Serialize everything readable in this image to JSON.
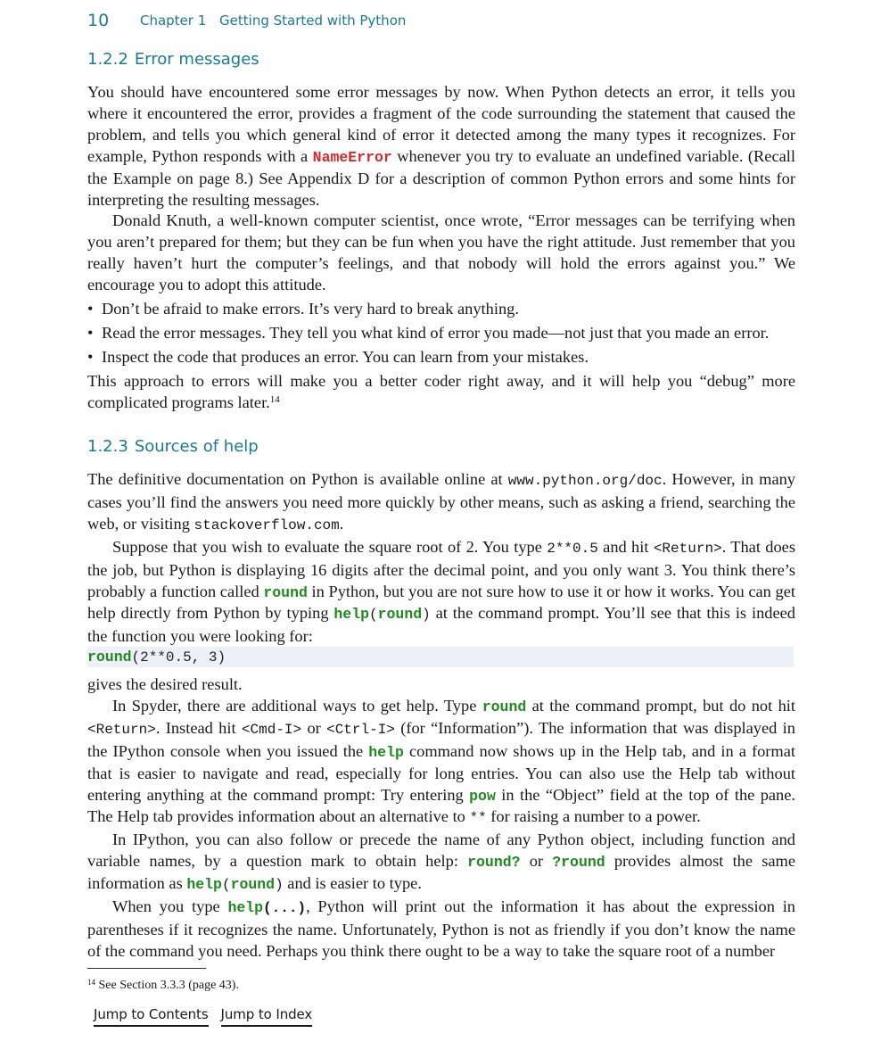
{
  "header": {
    "page_number": "10",
    "chapter_label": "Chapter 1",
    "chapter_title": "Getting Started with Python"
  },
  "section_122": {
    "number": "1.2.2",
    "title": "Error messages",
    "p1_a": "You should have encountered some error messages by now. When Python detects an error, it tells you where it encountered the error, provides a fragment of the code surrounding the statement that caused the problem, and tells you which general kind of error it detected among the many types it recognizes. For example, Python responds with a ",
    "p1_code": "NameError",
    "p1_b": " whenever you try to evaluate an undefined variable. (Recall the Example on page 8.) See Appendix D for a description of common Python errors and some hints for interpreting the resulting messages.",
    "p2": "Donald Knuth, a well-known computer scientist, once wrote, “Error messages can be terrifying when you aren’t prepared for them; but they can be fun when you have the right attitude. Just remember that you really haven’t hurt the computer’s feelings, and that nobody will hold the errors against you.” We encourage you to adopt this attitude.",
    "bullet_glyph": "•",
    "bullets": [
      "Don’t be afraid to make errors. It’s very hard to break anything.",
      "Read the error messages. They tell you what kind of error you made—not just that you made an error.",
      "Inspect the code that produces an error. You can learn from your mistakes."
    ],
    "p3": "This approach to errors will make you a better coder right away, and it will help you “debug” more complicated programs later.",
    "p3_footnote_mark": "14"
  },
  "section_123": {
    "number": "1.2.3",
    "title": "Sources of help",
    "p1_a": "The definitive documentation on Python is available online at ",
    "p1_url1": "www.python.org/doc",
    "p1_b": ". However, in many cases you’ll find the answers you need more quickly by other means, such as asking a friend, searching the web, or visiting ",
    "p1_url2": "stackoverflow.com",
    "p1_c": ".",
    "p2_a": "Suppose that you wish to evaluate the square root of 2. You type ",
    "p2_code1": "2**0.5",
    "p2_b": " and hit ",
    "p2_code2": "<Return>",
    "p2_c": ". That does the job, but Python is displaying 16 digits after the decimal point, and you only want 3. You think there’s probably a function called ",
    "p2_kw1": "round",
    "p2_d": " in Python, but you are not sure how to use it or how it works. You can get help directly from Python by typing ",
    "p2_kw2": "help",
    "p2_paren_open": "(",
    "p2_kw3": "round",
    "p2_paren_close": ")",
    "p2_e": " at the command prompt. You’ll see that this is indeed the function you were looking for:",
    "codeblock_kw": "round",
    "codeblock_rest": "(2**0.5, 3)",
    "p3": "gives the desired result.",
    "p4_a": "In Spyder, there are additional ways to get help. Type ",
    "p4_kw1": "round",
    "p4_b": " at the command prompt, but do not hit ",
    "p4_code1": "<Return>",
    "p4_c": ". Instead hit ",
    "p4_code2": "<Cmd-I>",
    "p4_d": " or ",
    "p4_code3": "<Ctrl-I>",
    "p4_e": " (for “Information”). The information that was displayed in the IPython console when you issued the ",
    "p4_kw2": "help",
    "p4_f": " command now shows up in the Help tab, and in a format that is easier to navigate and read, especially for long entries. You can also use the Help tab without entering anything at the command prompt: Try entering ",
    "p4_kw3": "pow",
    "p4_g": " in the “Object” field at the top of the pane. The Help tab provides information about an alternative to ",
    "p4_code4": "**",
    "p4_h": " for raising a number to a power.",
    "p5_a": "In IPython, you can also follow or precede the name of any Python object, including function and variable names, by a question mark to obtain help: ",
    "p5_kw1": "round?",
    "p5_b": " or ",
    "p5_kw2": "?round",
    "p5_c": " provides almost the same information as ",
    "p5_kw3": "help",
    "p5_paren_open": "(",
    "p5_kw4": "round",
    "p5_paren_close": ")",
    "p5_d": " and is easier to type.",
    "p6_a": "When you type ",
    "p6_kw1": "help",
    "p6_paren": "(...)",
    "p6_b": ", Python will print out the information it has about the expression in parentheses if it recognizes the name. Unfortunately, Python is not as friendly if you don’t know the name of the command you need. Perhaps you think there ought to be a way to take the square root of a number"
  },
  "footnote": {
    "mark": "14",
    "text": " See Section 3.3.3 (page 43)."
  },
  "nav": {
    "contents_link": "Jump to Contents",
    "index_link": "Jump to Index"
  },
  "colors": {
    "heading": "#1a7a94",
    "keyword": "#1f8a1f",
    "error": "#d42a2a",
    "codeblock_bg": "#eef0f8"
  }
}
